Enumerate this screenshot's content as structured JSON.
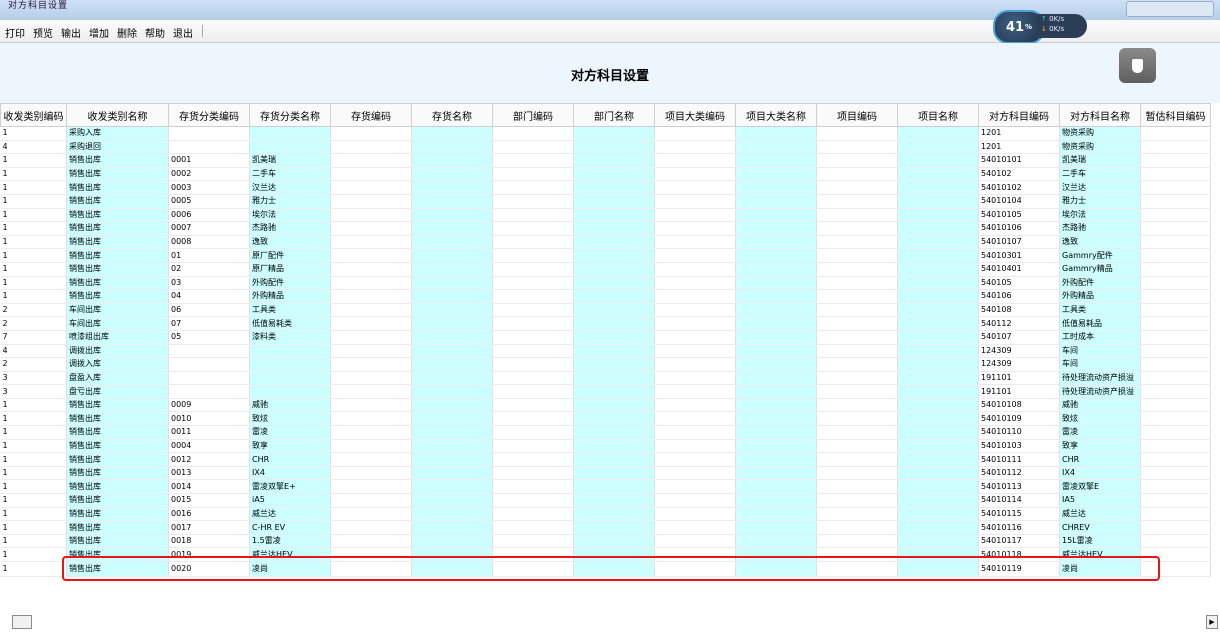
{
  "window": {
    "title": "对方科目设置"
  },
  "menu": [
    "打印",
    "预览",
    "输出",
    "增加",
    "删除",
    "帮助",
    "退出"
  ],
  "network": {
    "percent": "41",
    "unit": "%",
    "up": "0K/s",
    "down": "0K/s"
  },
  "header": {
    "title": "对方科目设置"
  },
  "usb_icon": "usb-drive-icon",
  "columns": [
    "收发类别编码",
    "收发类别名称",
    "存货分类编码",
    "存货分类名称",
    "存货编码",
    "存货名称",
    "部门编码",
    "部门名称",
    "项目大类编码",
    "项目大类名称",
    "项目编码",
    "项目名称",
    "对方科目编码",
    "对方科目名称",
    "暂估科目编码"
  ],
  "rows": [
    [
      "1",
      "采购入库",
      "",
      "",
      "",
      "",
      "",
      "",
      "",
      "",
      "",
      "",
      "1201",
      "物资采购",
      ""
    ],
    [
      "4",
      "采购退回",
      "",
      "",
      "",
      "",
      "",
      "",
      "",
      "",
      "",
      "",
      "1201",
      "物资采购",
      ""
    ],
    [
      "1",
      "销售出库",
      "0001",
      "凯美瑞",
      "",
      "",
      "",
      "",
      "",
      "",
      "",
      "",
      "54010101",
      "凯美瑞",
      ""
    ],
    [
      "1",
      "销售出库",
      "0002",
      "二手车",
      "",
      "",
      "",
      "",
      "",
      "",
      "",
      "",
      "540102",
      "二手车",
      ""
    ],
    [
      "1",
      "销售出库",
      "0003",
      "汉兰达",
      "",
      "",
      "",
      "",
      "",
      "",
      "",
      "",
      "54010102",
      "汉兰达",
      ""
    ],
    [
      "1",
      "销售出库",
      "0005",
      "雅力士",
      "",
      "",
      "",
      "",
      "",
      "",
      "",
      "",
      "54010104",
      "雅力士",
      ""
    ],
    [
      "1",
      "销售出库",
      "0006",
      "埃尔法",
      "",
      "",
      "",
      "",
      "",
      "",
      "",
      "",
      "54010105",
      "埃尔法",
      ""
    ],
    [
      "1",
      "销售出库",
      "0007",
      "杰路驰",
      "",
      "",
      "",
      "",
      "",
      "",
      "",
      "",
      "54010106",
      "杰路驰",
      ""
    ],
    [
      "1",
      "销售出库",
      "0008",
      "逸致",
      "",
      "",
      "",
      "",
      "",
      "",
      "",
      "",
      "54010107",
      "逸致",
      ""
    ],
    [
      "1",
      "销售出库",
      "01",
      "原厂配件",
      "",
      "",
      "",
      "",
      "",
      "",
      "",
      "",
      "54010301",
      "Gammry配件",
      ""
    ],
    [
      "1",
      "销售出库",
      "02",
      "原厂精品",
      "",
      "",
      "",
      "",
      "",
      "",
      "",
      "",
      "54010401",
      "Gammry精品",
      ""
    ],
    [
      "1",
      "销售出库",
      "03",
      "外购配件",
      "",
      "",
      "",
      "",
      "",
      "",
      "",
      "",
      "540105",
      "外购配件",
      ""
    ],
    [
      "1",
      "销售出库",
      "04",
      "外购精品",
      "",
      "",
      "",
      "",
      "",
      "",
      "",
      "",
      "540106",
      "外购精品",
      ""
    ],
    [
      "2",
      "车间出库",
      "06",
      "工具类",
      "",
      "",
      "",
      "",
      "",
      "",
      "",
      "",
      "540108",
      "工具类",
      ""
    ],
    [
      "2",
      "车间出库",
      "07",
      "低值易耗类",
      "",
      "",
      "",
      "",
      "",
      "",
      "",
      "",
      "540112",
      "低值易耗品",
      ""
    ],
    [
      "7",
      "喷漆组出库",
      "05",
      "漆料类",
      "",
      "",
      "",
      "",
      "",
      "",
      "",
      "",
      "540107",
      "工时成本",
      ""
    ],
    [
      "4",
      "调拨出库",
      "",
      "",
      "",
      "",
      "",
      "",
      "",
      "",
      "",
      "",
      "124309",
      "车间",
      ""
    ],
    [
      "2",
      "调拨入库",
      "",
      "",
      "",
      "",
      "",
      "",
      "",
      "",
      "",
      "",
      "124309",
      "车间",
      ""
    ],
    [
      "3",
      "盘盈入库",
      "",
      "",
      "",
      "",
      "",
      "",
      "",
      "",
      "",
      "",
      "191101",
      "待处理流动资产损溢",
      ""
    ],
    [
      "3",
      "盘亏出库",
      "",
      "",
      "",
      "",
      "",
      "",
      "",
      "",
      "",
      "",
      "191101",
      "待处理流动资产损溢",
      ""
    ],
    [
      "1",
      "销售出库",
      "0009",
      "威驰",
      "",
      "",
      "",
      "",
      "",
      "",
      "",
      "",
      "54010108",
      "威驰",
      ""
    ],
    [
      "1",
      "销售出库",
      "0010",
      "致炫",
      "",
      "",
      "",
      "",
      "",
      "",
      "",
      "",
      "54010109",
      "致炫",
      ""
    ],
    [
      "1",
      "销售出库",
      "0011",
      "雷凌",
      "",
      "",
      "",
      "",
      "",
      "",
      "",
      "",
      "54010110",
      "雷凌",
      ""
    ],
    [
      "1",
      "销售出库",
      "0004",
      "致享",
      "",
      "",
      "",
      "",
      "",
      "",
      "",
      "",
      "54010103",
      "致享",
      ""
    ],
    [
      "1",
      "销售出库",
      "0012",
      "CHR",
      "",
      "",
      "",
      "",
      "",
      "",
      "",
      "",
      "54010111",
      "CHR",
      ""
    ],
    [
      "1",
      "销售出库",
      "0013",
      "IX4",
      "",
      "",
      "",
      "",
      "",
      "",
      "",
      "",
      "54010112",
      "IX4",
      ""
    ],
    [
      "1",
      "销售出库",
      "0014",
      "雷凌双擎E+",
      "",
      "",
      "",
      "",
      "",
      "",
      "",
      "",
      "54010113",
      "雷凌双擎E",
      ""
    ],
    [
      "1",
      "销售出库",
      "0015",
      "iA5",
      "",
      "",
      "",
      "",
      "",
      "",
      "",
      "",
      "54010114",
      "IA5",
      ""
    ],
    [
      "1",
      "销售出库",
      "0016",
      "威兰达",
      "",
      "",
      "",
      "",
      "",
      "",
      "",
      "",
      "54010115",
      "威兰达",
      ""
    ],
    [
      "1",
      "销售出库",
      "0017",
      "C-HR EV",
      "",
      "",
      "",
      "",
      "",
      "",
      "",
      "",
      "54010116",
      "CHREV",
      ""
    ],
    [
      "1",
      "销售出库",
      "0018",
      "1.5雷凌",
      "",
      "",
      "",
      "",
      "",
      "",
      "",
      "",
      "54010117",
      "15L雷凌",
      ""
    ],
    [
      "1",
      "销售出库",
      "0019",
      "威兰达HEV",
      "",
      "",
      "",
      "",
      "",
      "",
      "",
      "",
      "54010118",
      "威兰达HEV",
      ""
    ],
    [
      "1",
      "销售出库",
      "0020",
      "凌尚",
      "",
      "",
      "",
      "",
      "",
      "",
      "",
      "",
      "54010119",
      "凌尚",
      ""
    ]
  ]
}
